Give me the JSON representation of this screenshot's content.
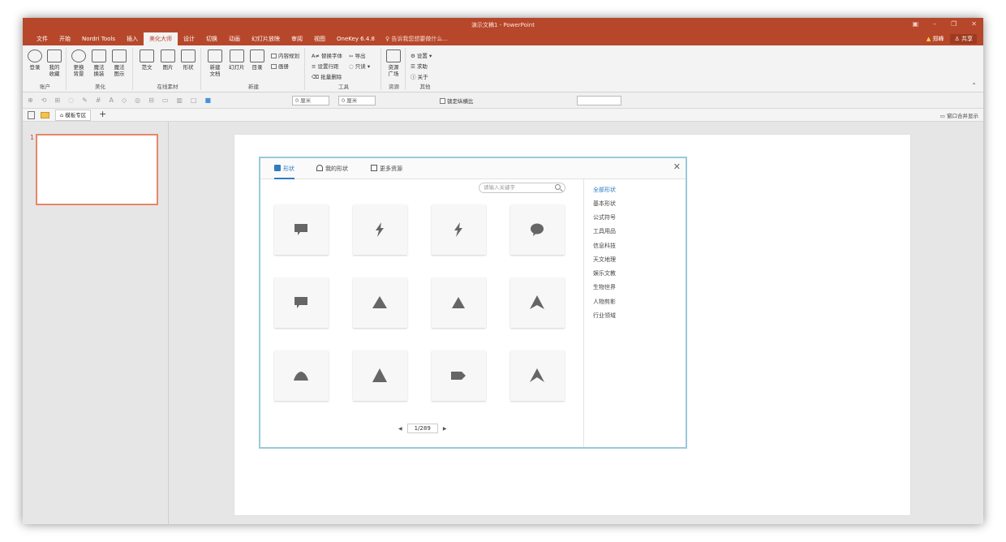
{
  "window": {
    "title": "演示文稿1 - PowerPoint"
  },
  "menu": {
    "tabs": [
      "文件",
      "开始",
      "Nordri Tools",
      "插入",
      "美化大师",
      "设计",
      "切换",
      "动画",
      "幻灯片放映",
      "审阅",
      "视图",
      "OneKey 6.4.8"
    ],
    "active_index": 4,
    "tell_me": "告诉我您想要做什么...",
    "user": "郑峰",
    "share": "共享"
  },
  "ribbon": {
    "account": {
      "login": "登录",
      "favorites_1": "我的",
      "favorites_2": "收藏",
      "label": "账户"
    },
    "beautify": {
      "b1_1": "更换",
      "b1_2": "背景",
      "b2_1": "魔法",
      "b2_2": "换装",
      "b3_1": "魔法",
      "b3_2": "图示",
      "label": "美化"
    },
    "online": {
      "template": "范文",
      "picture": "图片",
      "shape": "形状",
      "label": "在线素材"
    },
    "new": {
      "doc_1": "新建",
      "doc_2": "文档",
      "slide": "幻灯片",
      "toc": "目录",
      "plan": "内容规划",
      "album": "画册",
      "label": "新建"
    },
    "tools": {
      "replace_font": "替换字体",
      "export": "导出",
      "line_spacing": "设置行距",
      "readonly": "只读",
      "batch_delete": "批量删除",
      "label": "工具"
    },
    "resources": {
      "r1": "资源",
      "r2": "广场",
      "label": "资源"
    },
    "other": {
      "settings": "设置",
      "help": "求助",
      "about": "关于",
      "label": "其他"
    }
  },
  "toolbar2": {
    "width_value": "0 厘米",
    "height_value": "0 厘米",
    "lock_ratio": "锁定纵横比"
  },
  "tabstrip": {
    "template_tab": "模板专区",
    "merge_windows": "窗口合并显示"
  },
  "slides": {
    "number": "1"
  },
  "dialog": {
    "tabs": [
      "形状",
      "我的形状",
      "更多资源"
    ],
    "search_placeholder": "请输入关键字",
    "page_indicator": "1/289",
    "categories": [
      "全部形状",
      "基本形状",
      "公式符号",
      "工具用品",
      "信息科技",
      "天文地理",
      "娱乐文教",
      "生物世界",
      "人物剪影",
      "行业领域"
    ],
    "icons": [
      "speech-bubble-rect-icon",
      "lightning-bolt-icon",
      "lightning-bolt-icon",
      "speech-bubble-oval-icon",
      "callout-rect-icon",
      "triangle-icon",
      "triangle-icon",
      "arrowhead-icon",
      "rounded-trapezoid-icon",
      "triangle-icon",
      "pentagon-arrow-icon",
      "arrowhead-icon"
    ]
  },
  "colors": {
    "accent": "#b7472a",
    "link_blue": "#2d7cc1",
    "icon_gray": "#666666"
  }
}
